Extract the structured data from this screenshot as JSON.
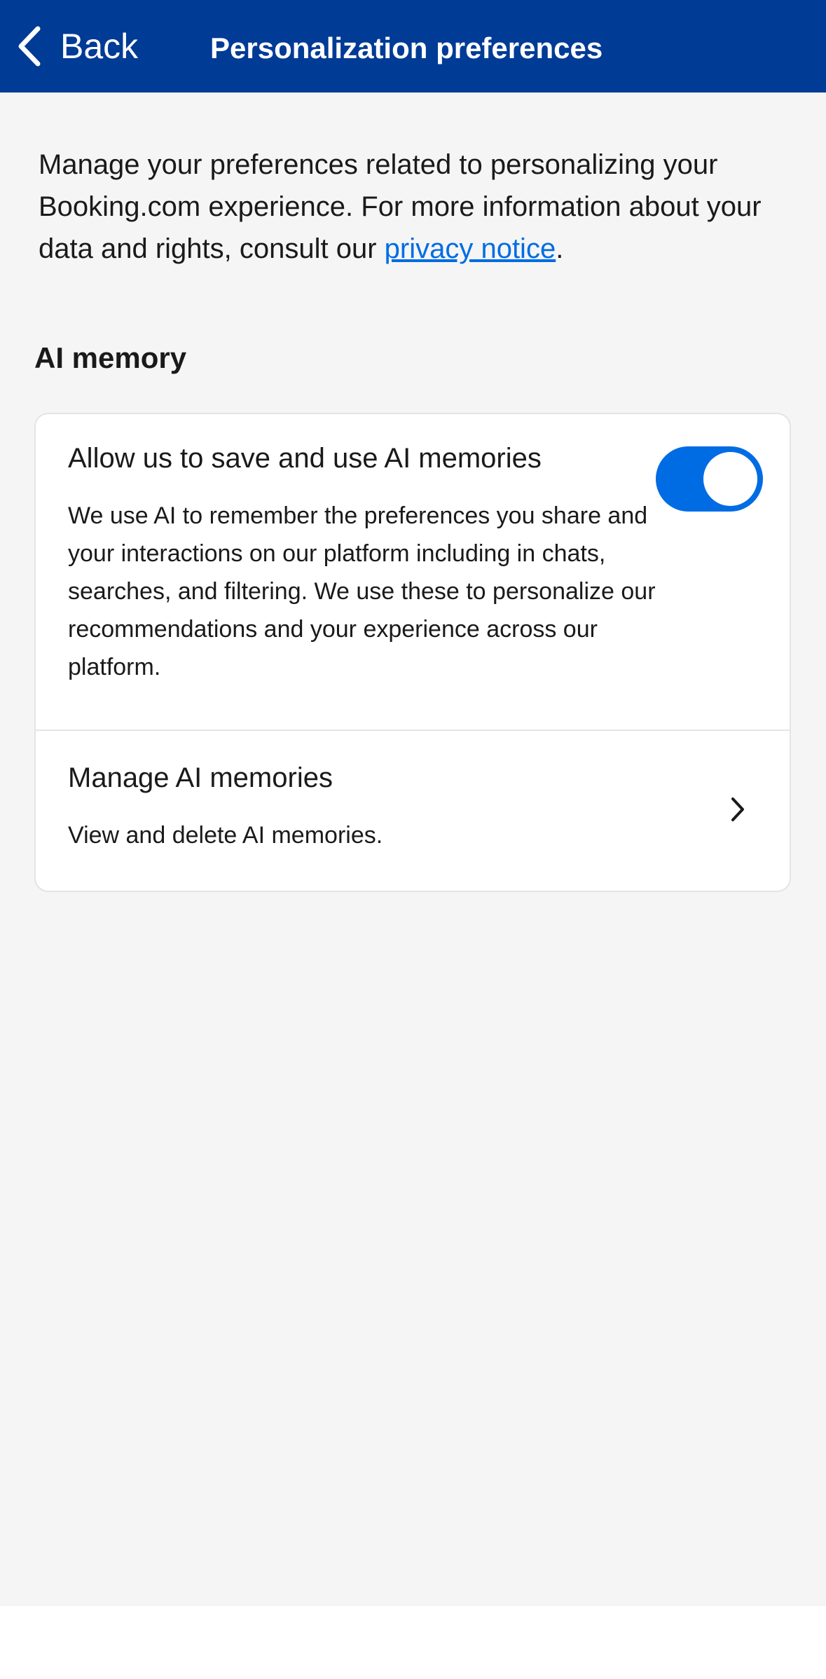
{
  "nav": {
    "back_label": "Back",
    "title": "Personalization preferences",
    "back_icon": "chevron-left-icon"
  },
  "intro": {
    "text_before_link": "Manage your preferences related to personalizing your Booking.com experience. For more information about your data and rights, consult our ",
    "link_text": "privacy notice",
    "text_after_link": "."
  },
  "section": {
    "title": "AI memory"
  },
  "ai_memory": {
    "title": "Allow us to save and use AI memories",
    "description": "We use AI to remember the preferences you share and your interactions on our platform including in chats, searches, and filtering. We use these to personalize our recommendations and your experience across our platform.",
    "toggle_on": true
  },
  "manage": {
    "title": "Manage AI memories",
    "description": "View and delete AI memories.",
    "icon": "chevron-right-icon"
  },
  "colors": {
    "header_bg": "#003b95",
    "accent": "#006ce4",
    "page_bg": "#f5f5f5"
  }
}
